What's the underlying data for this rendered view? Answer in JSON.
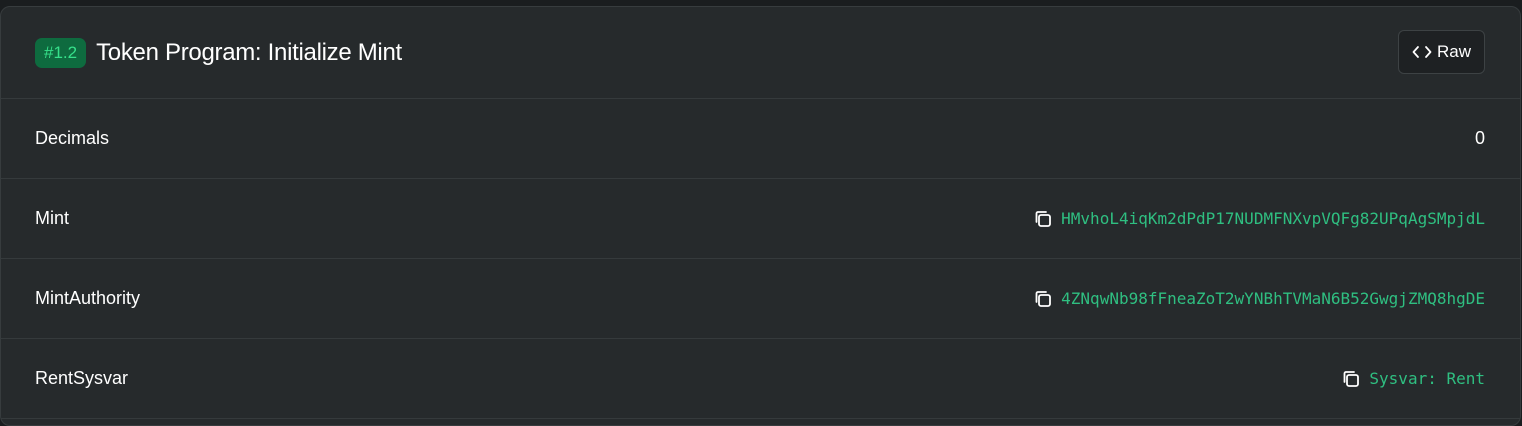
{
  "header": {
    "badge": "#1.2",
    "title": "Token Program: Initialize Mint",
    "raw_label": "Raw"
  },
  "rows": [
    {
      "label": "Decimals",
      "value": "0"
    },
    {
      "label": "Mint",
      "value": "HMvhoL4iqKm2dPdP17NUDMFNXvpVQFg82UPqAgSMpjdL",
      "icon": "copy-icon"
    },
    {
      "label": "MintAuthority",
      "value": "4ZNqwNb98fFneaZoT2wYNBhTVMaN6B52GwgjZMQ8hgDE",
      "icon": "copy-icon"
    },
    {
      "label": "RentSysvar",
      "value": "Sysvar: Rent",
      "icon": "copy-icon"
    }
  ],
  "colors": {
    "background": "#262a2c",
    "badge_bg": "#0e6b3f",
    "badge_text": "#36e08a",
    "address": "#2fbf81"
  }
}
